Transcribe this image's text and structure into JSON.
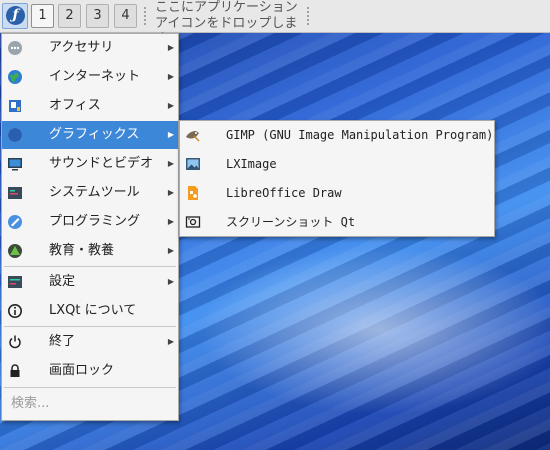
{
  "taskbar": {
    "workspaces": [
      "1",
      "2",
      "3",
      "4"
    ],
    "active_workspace": "1",
    "quicklaunch_hint": [
      "ここにアプリケーション",
      "アイコンをドロップします"
    ]
  },
  "menu": {
    "items": [
      {
        "label": "アクセサリ",
        "icon": "accessories-icon",
        "has_submenu": true
      },
      {
        "label": "インターネット",
        "icon": "globe-icon",
        "has_submenu": true
      },
      {
        "label": "オフィス",
        "icon": "office-icon",
        "has_submenu": true
      },
      {
        "label": "グラフィックス",
        "icon": "graphics-icon",
        "has_submenu": true,
        "selected": true
      },
      {
        "label": "サウンドとビデオ",
        "icon": "multimedia-icon",
        "has_submenu": true
      },
      {
        "label": "システムツール",
        "icon": "system-tools-icon",
        "has_submenu": true
      },
      {
        "label": "プログラミング",
        "icon": "programming-icon",
        "has_submenu": true
      },
      {
        "label": "教育・教養",
        "icon": "education-icon",
        "has_submenu": true
      },
      {
        "label": "設定",
        "icon": "settings-icon",
        "has_submenu": true
      },
      {
        "label": "LXQt について",
        "icon": "info-icon",
        "has_submenu": false
      },
      {
        "label": "終了",
        "icon": "power-icon",
        "has_submenu": true
      },
      {
        "label": "画面ロック",
        "icon": "lock-icon",
        "has_submenu": false
      }
    ],
    "search_placeholder": "検索..."
  },
  "submenu": {
    "items": [
      {
        "label": "GIMP (GNU Image Manipulation Program)",
        "icon": "gimp-icon"
      },
      {
        "label": "LXImage",
        "icon": "image-viewer-icon"
      },
      {
        "label": "LibreOffice Draw",
        "icon": "libreoffice-draw-icon"
      },
      {
        "label": "スクリーンショット Qt",
        "icon": "screenshot-icon"
      }
    ]
  },
  "colors": {
    "selection": "#3d87d9",
    "menu_background": "#f5f5f5",
    "taskbar_background": "#e8e8e8"
  }
}
